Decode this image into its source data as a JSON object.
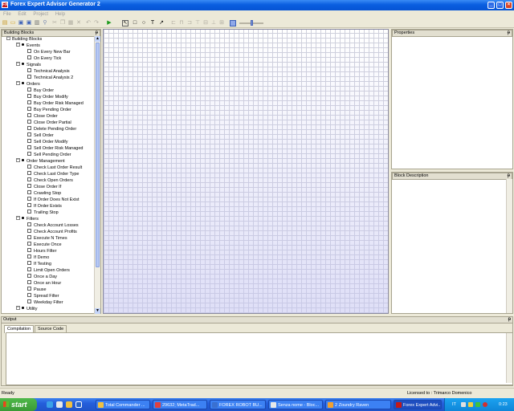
{
  "window": {
    "title": "Forex Expert Advisor Generator 2",
    "app_icon": "FX"
  },
  "menu": [
    "File",
    "Edit",
    "Project",
    "Help"
  ],
  "panels": {
    "building_blocks": "Building Blocks",
    "properties": "Properties",
    "block_description": "Block Description",
    "output": "Output"
  },
  "tree": [
    {
      "label": "Building Blocks",
      "level": 0,
      "kind": "root"
    },
    {
      "label": "Events",
      "level": 1,
      "kind": "group"
    },
    {
      "label": "On Every New Bar",
      "level": 2,
      "kind": "leaf"
    },
    {
      "label": "On Every Tick",
      "level": 2,
      "kind": "leaf"
    },
    {
      "label": "Signals",
      "level": 1,
      "kind": "group"
    },
    {
      "label": "Technical Analysis",
      "level": 2,
      "kind": "leaf"
    },
    {
      "label": "Technical Analysis 2",
      "level": 2,
      "kind": "leaf"
    },
    {
      "label": "Orders",
      "level": 1,
      "kind": "group"
    },
    {
      "label": "Buy Order",
      "level": 2,
      "kind": "leaf"
    },
    {
      "label": "Buy Order Modify",
      "level": 2,
      "kind": "leaf"
    },
    {
      "label": "Buy Order Risk Managed",
      "level": 2,
      "kind": "leaf"
    },
    {
      "label": "Buy Pending Order",
      "level": 2,
      "kind": "leaf"
    },
    {
      "label": "Close Order",
      "level": 2,
      "kind": "leaf"
    },
    {
      "label": "Close Order Partial",
      "level": 2,
      "kind": "leaf"
    },
    {
      "label": "Delete Pending Order",
      "level": 2,
      "kind": "leaf"
    },
    {
      "label": "Sell Order",
      "level": 2,
      "kind": "leaf"
    },
    {
      "label": "Sell Order Modify",
      "level": 2,
      "kind": "leaf"
    },
    {
      "label": "Sell Order Risk Managed",
      "level": 2,
      "kind": "leaf"
    },
    {
      "label": "Sell Pending Order",
      "level": 2,
      "kind": "leaf"
    },
    {
      "label": "Order Management",
      "level": 1,
      "kind": "group"
    },
    {
      "label": "Check Last Order Result",
      "level": 2,
      "kind": "leaf"
    },
    {
      "label": "Check Last Order Type",
      "level": 2,
      "kind": "leaf"
    },
    {
      "label": "Check Open Orders",
      "level": 2,
      "kind": "leaf"
    },
    {
      "label": "Close Order If",
      "level": 2,
      "kind": "leaf"
    },
    {
      "label": "Crawling Stop",
      "level": 2,
      "kind": "leaf"
    },
    {
      "label": "If Order Does Not Exist",
      "level": 2,
      "kind": "leaf"
    },
    {
      "label": "If Order Exists",
      "level": 2,
      "kind": "leaf"
    },
    {
      "label": "Trailing Stop",
      "level": 2,
      "kind": "leaf"
    },
    {
      "label": "Filters",
      "level": 1,
      "kind": "group"
    },
    {
      "label": "Check Account Losses",
      "level": 2,
      "kind": "leaf"
    },
    {
      "label": "Check Account Profits",
      "level": 2,
      "kind": "leaf"
    },
    {
      "label": "Execute N Times",
      "level": 2,
      "kind": "leaf"
    },
    {
      "label": "Execute Once",
      "level": 2,
      "kind": "leaf"
    },
    {
      "label": "Hours Filter",
      "level": 2,
      "kind": "leaf"
    },
    {
      "label": "If Demo",
      "level": 2,
      "kind": "leaf"
    },
    {
      "label": "If Testing",
      "level": 2,
      "kind": "leaf"
    },
    {
      "label": "Limit Open Orders",
      "level": 2,
      "kind": "leaf"
    },
    {
      "label": "Once a Day",
      "level": 2,
      "kind": "leaf"
    },
    {
      "label": "Once an Hour",
      "level": 2,
      "kind": "leaf"
    },
    {
      "label": "Pause",
      "level": 2,
      "kind": "leaf"
    },
    {
      "label": "Spread Filter",
      "level": 2,
      "kind": "leaf"
    },
    {
      "label": "Weekday Filter",
      "level": 2,
      "kind": "leaf"
    },
    {
      "label": "Utility",
      "level": 1,
      "kind": "group"
    }
  ],
  "output_tabs": [
    "Compilation",
    "Source Code"
  ],
  "status": {
    "left": "Ready",
    "right": "Licensed to : Trimarco Domenico"
  },
  "taskbar": {
    "start": "start",
    "tasks": [
      "Total Commander ...",
      "29632; MetaTrad...",
      "FOREX ROBOT BU...",
      "Senza nome - Bloc...",
      "2 Zoundry Raven",
      "Forex Expert Advi..."
    ],
    "tray_code": "IT",
    "clock": "0:23"
  }
}
